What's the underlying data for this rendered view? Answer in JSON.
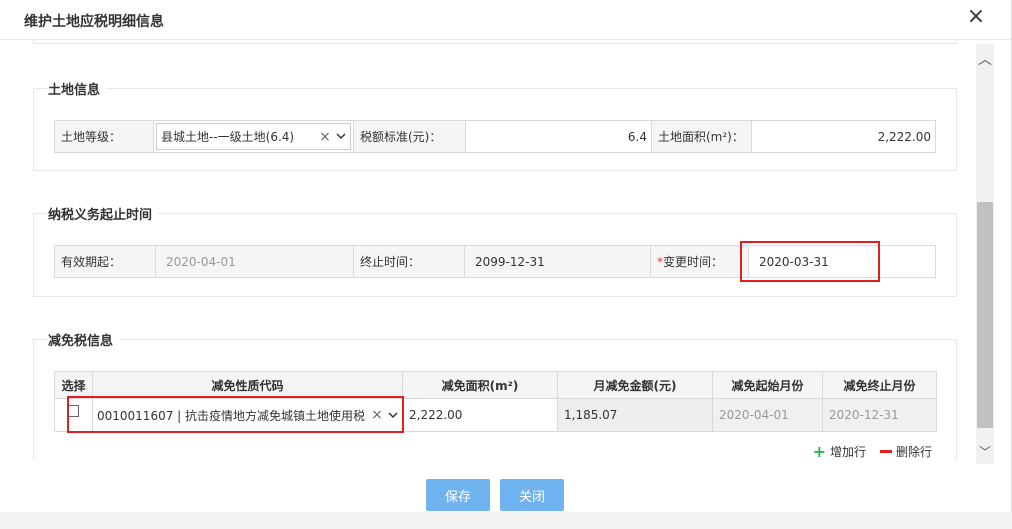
{
  "dialog": {
    "title": "维护土地应税明细信息",
    "close_icon": "close-icon"
  },
  "land_info": {
    "title": "土地信息",
    "grade_label": "土地等级：",
    "grade_value": "县城土地--一级土地(6.4)",
    "tax_standard_label": "税额标准(元)：",
    "tax_standard_value": "6.4",
    "area_label": "土地面积(m²)：",
    "area_value": "2,222.00"
  },
  "tax_period": {
    "title": "纳税义务起止时间",
    "start_label": "有效期起：",
    "start_value": "2020-04-01",
    "end_label": "终止时间：",
    "end_value": "2099-12-31",
    "change_required_mark": "*",
    "change_label": "变更时间：",
    "change_value": "2020-03-31"
  },
  "relief": {
    "title": "减免税信息",
    "columns": [
      "选择",
      "减免性质代码",
      "减免面积(m²)",
      "月减免金额(元)",
      "减免起始月份",
      "减免终止月份"
    ],
    "rows": [
      {
        "code": "0010011607 | 抗击疫情地方减免城镇土地使用税",
        "area": "2,222.00",
        "monthly_amount": "1,185.07",
        "start_month": "2020-04-01",
        "end_month": "2020-12-31"
      }
    ],
    "add_row": "增加行",
    "delete_row": "删除行"
  },
  "footer": {
    "save": "保存",
    "close": "关闭"
  },
  "colors": {
    "primary_button": "#6fb3f0",
    "highlight_box": "#e02020",
    "add_icon": "#2db14f"
  }
}
